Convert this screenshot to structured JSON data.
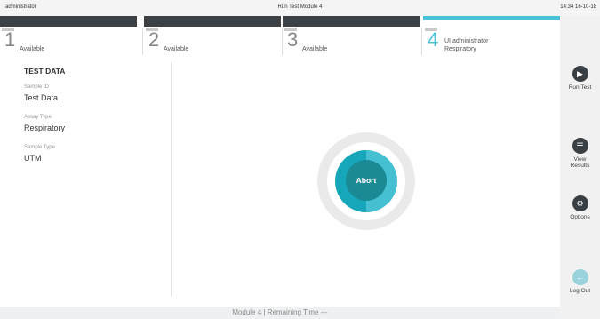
{
  "topbar": {
    "user": "administrator",
    "title": "Run Test Module 4",
    "clock": "14:34 16-10-18"
  },
  "modules": [
    {
      "number": "1",
      "status": "Available"
    },
    {
      "number": "2",
      "status": "Available"
    },
    {
      "number": "3",
      "status": "Available"
    },
    {
      "number": "4",
      "status_line1": "UI administrator",
      "status_line2": "Respiratory"
    }
  ],
  "sidebar": {
    "run_test": "Run Test",
    "view_results_1": "View",
    "view_results_2": "Results",
    "options": "Options",
    "log_out": "Log Out"
  },
  "test_data": {
    "heading": "TEST DATA",
    "sample_id_label": "Sample ID",
    "sample_id_value": "Test Data",
    "assay_type_label": "Assay Type",
    "assay_type_value": "Respiratory",
    "sample_type_label": "Sample Type",
    "sample_type_value": "UTM"
  },
  "center": {
    "abort_label": "Abort",
    "progress": 0.5
  },
  "status_bar": {
    "text": "Module 4  |  Remaining Time  ---"
  },
  "colors": {
    "accent": "#45c0d3",
    "accent_dark": "#1b8a95",
    "tab_strip": "#3b4045"
  }
}
